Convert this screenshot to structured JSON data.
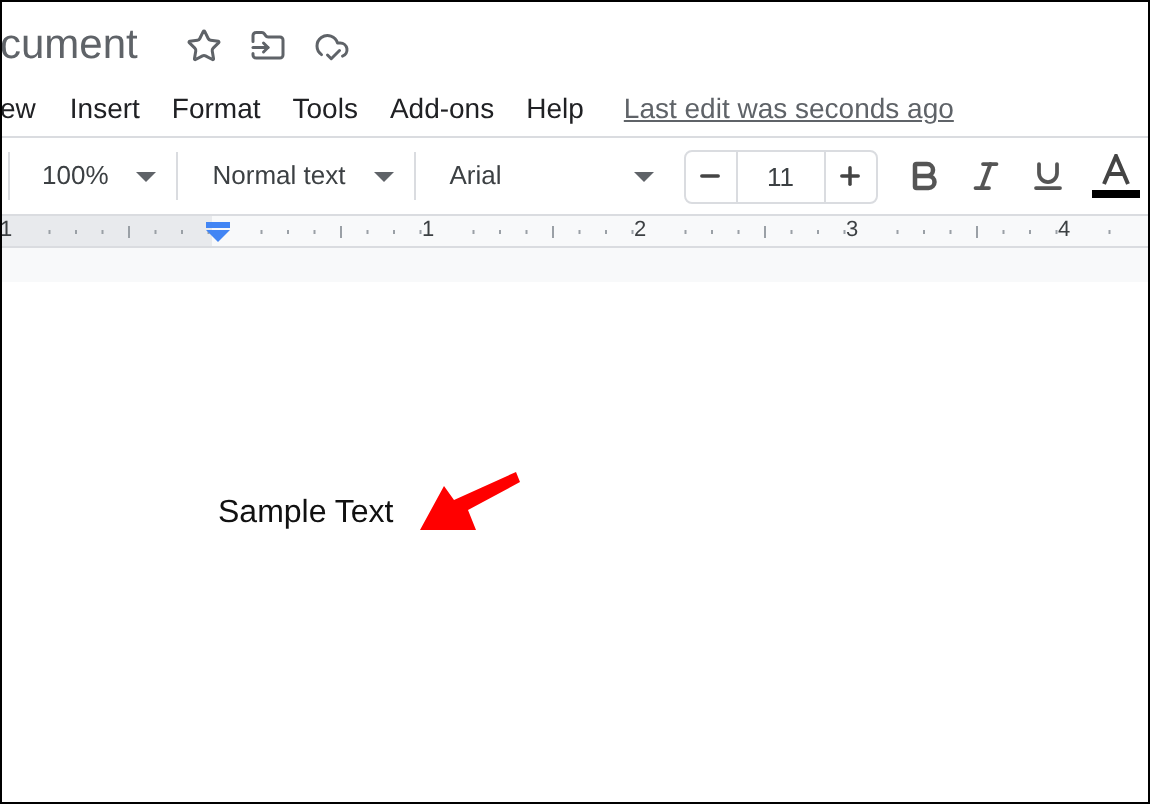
{
  "document_title": "cument",
  "menu": [
    {
      "label": "ew"
    },
    {
      "label": "Insert"
    },
    {
      "label": "Format"
    },
    {
      "label": "Tools"
    },
    {
      "label": "Add-ons"
    },
    {
      "label": "Help"
    }
  ],
  "last_edit": "Last edit was seconds ago",
  "toolbar": {
    "zoom": "100%",
    "style": "Normal text",
    "font": "Arial",
    "font_size": "11"
  },
  "ruler": {
    "labels": [
      "1",
      "1",
      "2",
      "3",
      "4"
    ]
  },
  "body_text": "Sample Text"
}
